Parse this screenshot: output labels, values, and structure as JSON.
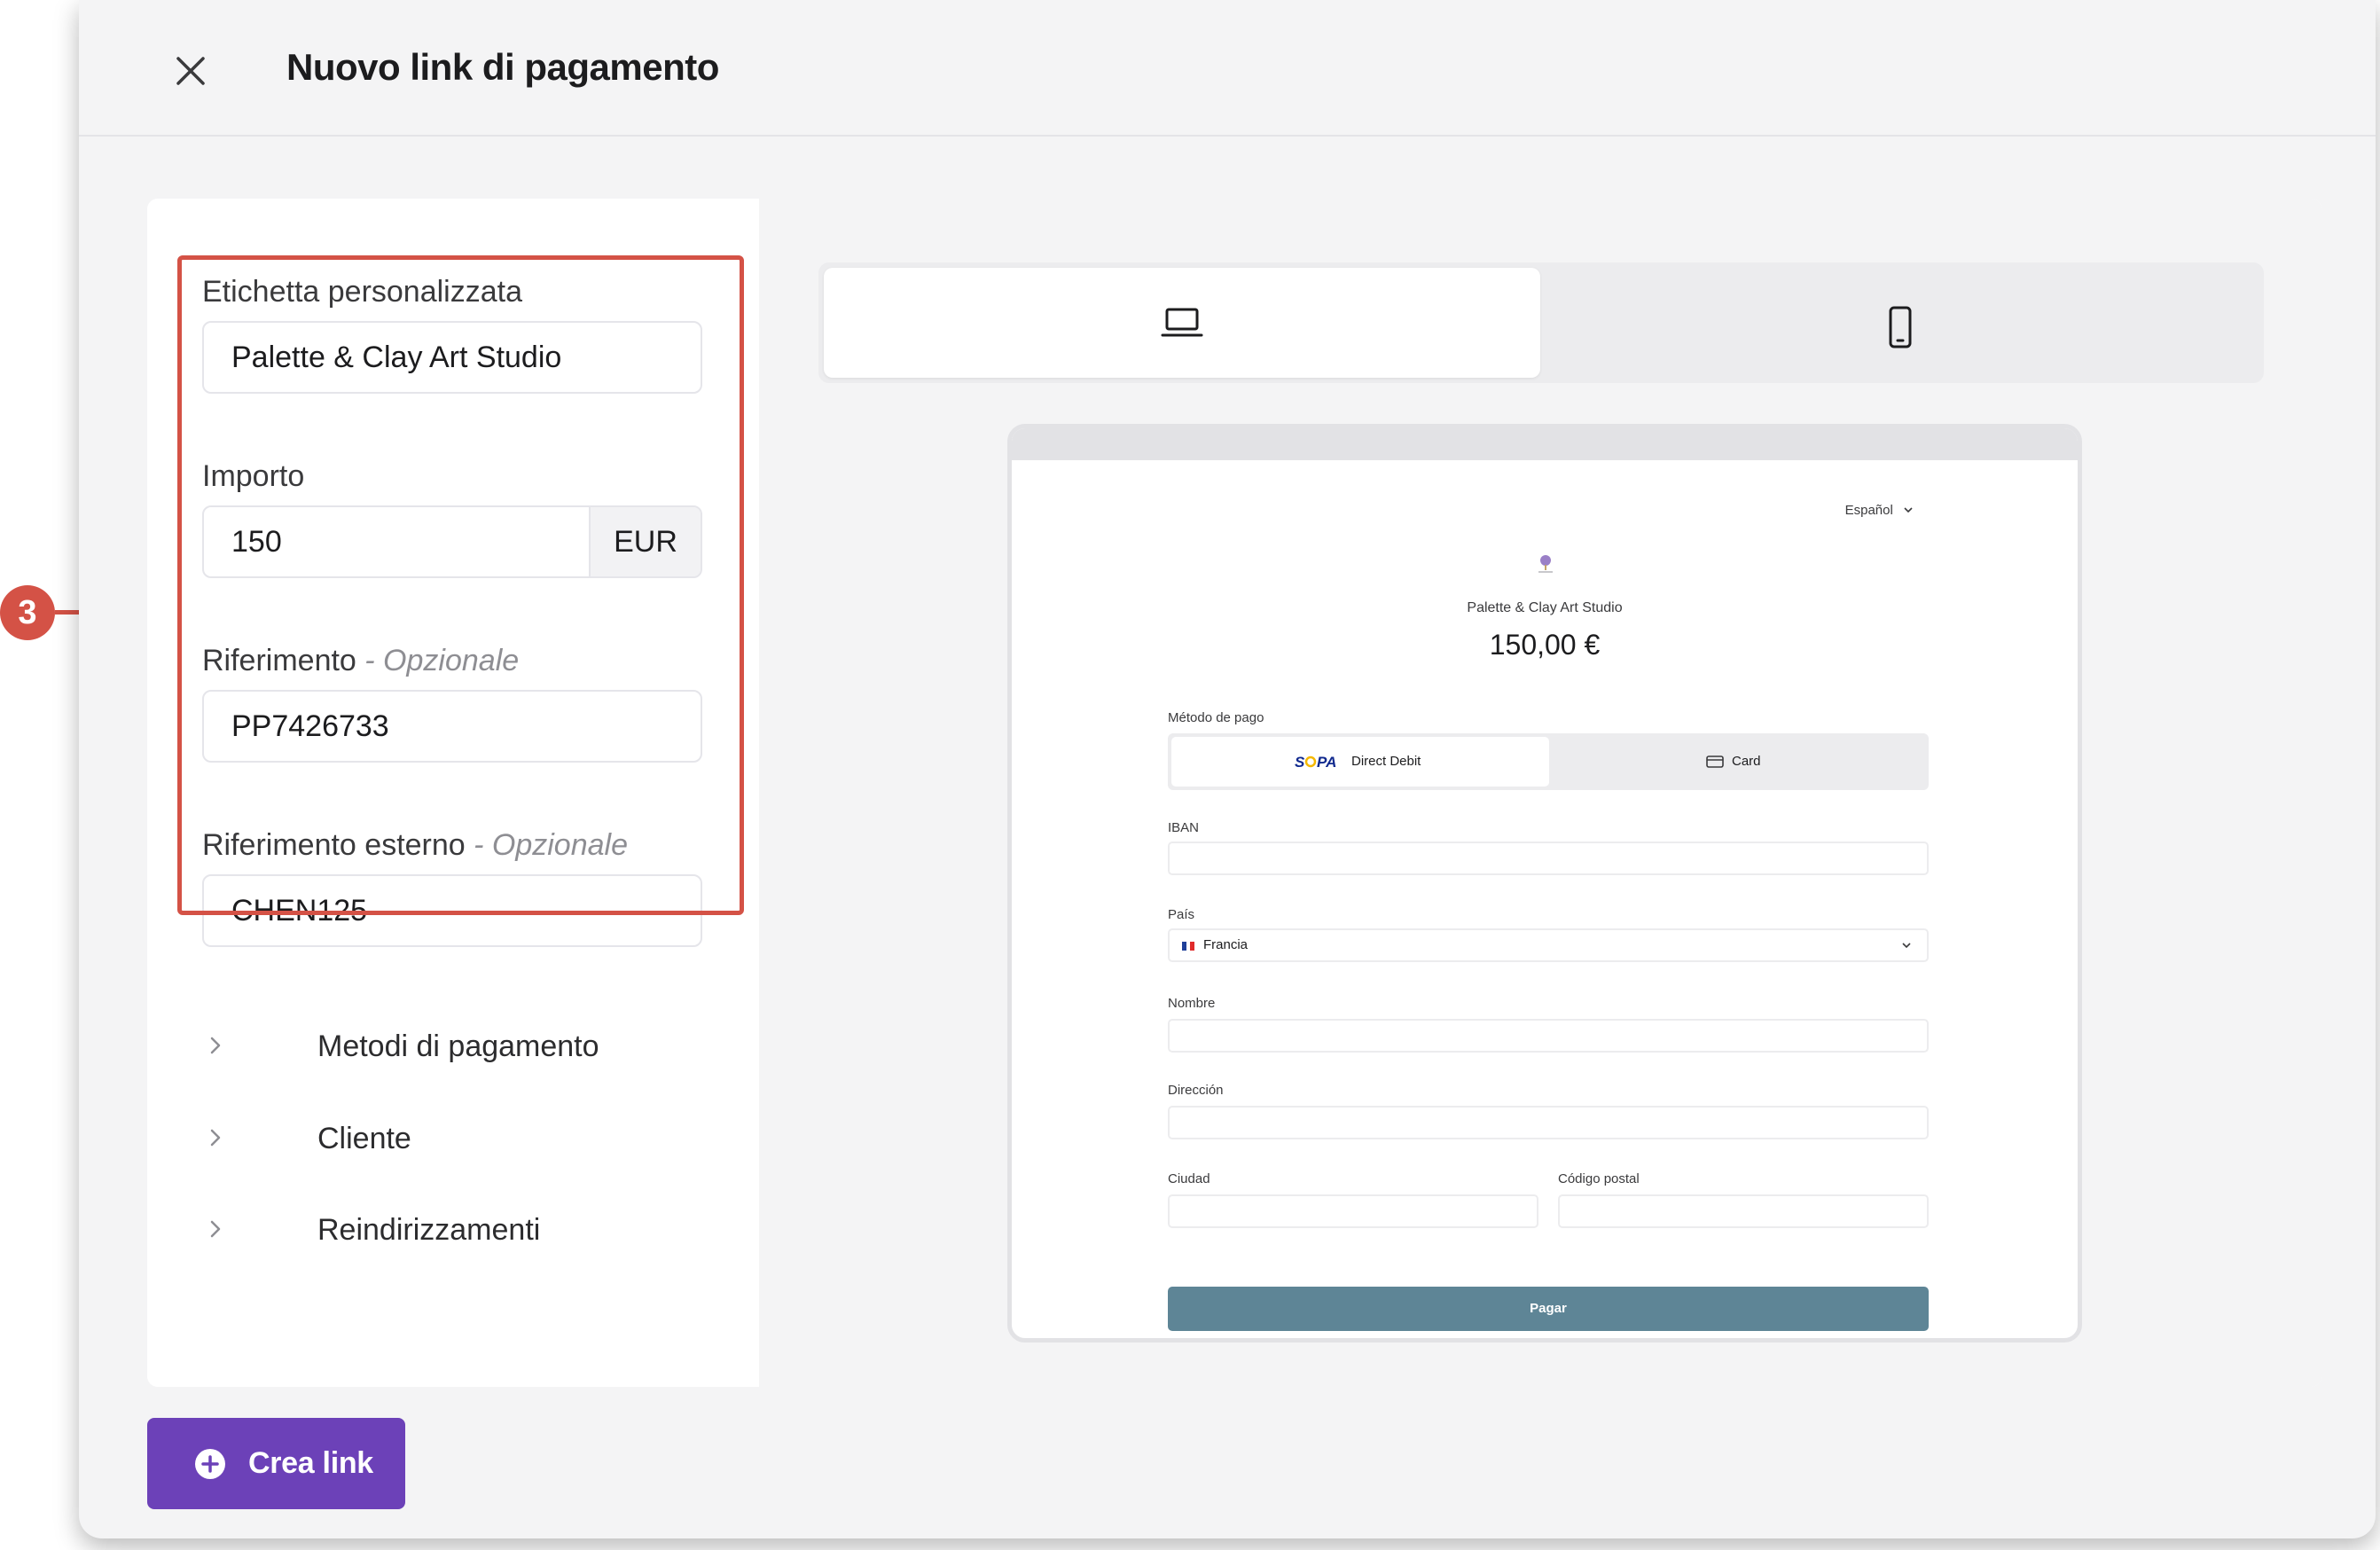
{
  "colors": {
    "accent_purple": "#6c41b8",
    "callout_red": "#d45246",
    "pay_button": "#5e8596",
    "modal_bg": "#f4f4f5"
  },
  "header": {
    "title": "Nuovo link di pagamento",
    "close_icon": "close-icon"
  },
  "callout": {
    "step": "3"
  },
  "form": {
    "custom_label": {
      "label": "Etichetta personalizzata",
      "value": "Palette & Clay Art Studio"
    },
    "amount": {
      "label": "Importo",
      "value": "150",
      "currency": "EUR"
    },
    "reference": {
      "label": "Riferimento",
      "optional": " - Opzionale",
      "value": "PP7426733"
    },
    "external_reference": {
      "label": "Riferimento esterno",
      "optional": " - Opzionale",
      "value": "CHEN125"
    },
    "sections": [
      {
        "label": "Metodi di pagamento",
        "icon": "chevron-right-icon"
      },
      {
        "label": "Cliente",
        "icon": "chevron-right-icon"
      },
      {
        "label": "Reindirizzamenti",
        "icon": "chevron-right-icon"
      }
    ]
  },
  "device_toggle": {
    "desktop_icon": "laptop-icon",
    "mobile_icon": "mobile-phone-icon",
    "selected": "desktop"
  },
  "preview": {
    "language": "Español",
    "merchant": "Palette & Clay Art Studio",
    "amount": "150,00 €",
    "payment_method_label": "Método de pago",
    "methods": [
      {
        "label": "Direct Debit",
        "logo": "SEPA",
        "selected": true
      },
      {
        "label": "Card",
        "icon": "credit-card-icon",
        "selected": false
      }
    ],
    "iban_label": "IBAN",
    "country_label": "País",
    "country_value": "Francia",
    "name_label": "Nombre",
    "address_label": "Dirección",
    "city_label": "Ciudad",
    "postal_label": "Código postal",
    "pay_button": "Pagar"
  },
  "footer": {
    "create_button": "Crea link",
    "create_icon": "plus-circle-icon"
  }
}
